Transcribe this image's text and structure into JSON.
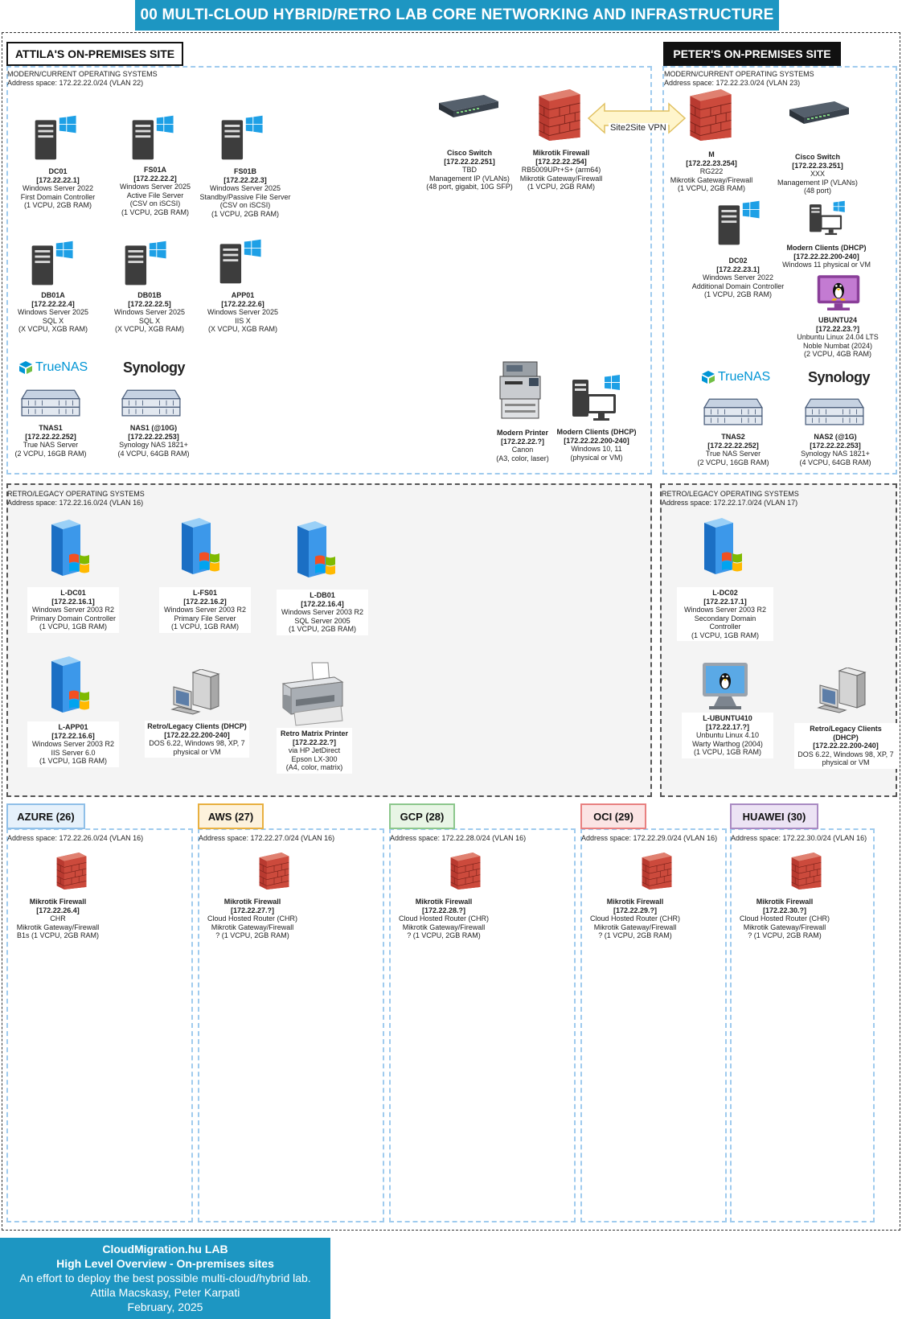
{
  "title": "00 MULTI-CLOUD HYBRID/RETRO LAB CORE NETWORKING AND INFRASTRUCTURE",
  "attila": {
    "label": "ATTILA'S ON-PREMISES SITE",
    "modern": {
      "heading": "MODERN/CURRENT OPERATING SYSTEMS",
      "address": "Address space: 172.22.22.0/24 (VLAN 22)"
    },
    "legacy": {
      "heading": "RETRO/LEGACY OPERATING SYSTEMS",
      "address": "Address space: 172.22.16.0/24 (VLAN 16)"
    },
    "devices": {
      "dc01": [
        "DC01",
        "[172.22.22.1]",
        "Windows Server 2022",
        "First Domain Controller",
        "(1 VCPU, 2GB RAM)"
      ],
      "fs01a": [
        "FS01A",
        "[172.22.22.2]",
        "Windows Server 2025",
        "Active File Server",
        "(CSV on iSCSI)",
        "(1 VCPU, 2GB RAM)"
      ],
      "fs01b": [
        "FS01B",
        "[172.22.22.3]",
        "Windows Server 2025",
        "Standby/Passive File Server",
        "(CSV on iSCSI)",
        "(1 VCPU, 2GB RAM)"
      ],
      "db01a": [
        "DB01A",
        "[172.22.22.4]",
        "Windows Server 2025",
        "SQL X",
        "(X VCPU, XGB RAM)"
      ],
      "db01b": [
        "DB01B",
        "[172.22.22.5]",
        "Windows Server 2025",
        "SQL X",
        "(X VCPU, XGB RAM)"
      ],
      "app01": [
        "APP01",
        "[172.22.22.6]",
        "Windows Server 2025",
        "IIS X",
        "(X VCPU, XGB RAM)"
      ],
      "switch": [
        "Cisco Switch",
        "[172.22.22.251]",
        "TBD",
        "Management IP (VLANs)",
        "(48 port, gigabit, 10G SFP)"
      ],
      "firewall": [
        "Mikrotik Firewall",
        "[172.22.22.254]",
        "RB5009UPr+S+ (arm64)",
        "Mikrotik Gateway/Firewall",
        "(1 VCPU, 2GB RAM)"
      ],
      "tnas1": [
        "TNAS1",
        "[172.22.22.252]",
        "True NAS Server",
        "(2 VCPU, 16GB RAM)"
      ],
      "nas1": [
        "NAS1 (@10G)",
        "[172.22.22.253]",
        "Synology NAS 1821+",
        "(4 VCPU, 64GB RAM)"
      ],
      "printer": [
        "Modern Printer",
        "[172.22.22.?]",
        "Canon",
        "(A3, color, laser)"
      ],
      "clients": [
        "Modern Clients (DHCP)",
        "[172.22.22.200-240]",
        "Windows 10, 11",
        "(physical or VM)"
      ],
      "ldc01": [
        "L-DC01",
        "[172.22.16.1]",
        "Windows Server 2003 R2",
        "Primary Domain Controller",
        "(1 VCPU, 1GB RAM)"
      ],
      "lfs01": [
        "L-FS01",
        "[172.22.16.2]",
        "Windows Server 2003 R2",
        "Primary File Server",
        "(1 VCPU, 1GB RAM)"
      ],
      "ldb01": [
        "L-DB01",
        "[172.22.16.4]",
        "Windows Server 2003 R2",
        "SQL Server 2005",
        "(1 VCPU, 2GB RAM)"
      ],
      "lapp01": [
        "L-APP01",
        "[172.22.16.6]",
        "Windows Server 2003 R2",
        "IIS Server 6.0",
        "(1 VCPU, 1GB RAM)"
      ],
      "retroclients": [
        "Retro/Legacy Clients (DHCP)",
        "[172.22.22.200-240]",
        "DOS 6.22, Windows 98, XP, 7",
        "physical or VM"
      ],
      "retroprinter": [
        "Retro Matrix Printer",
        "[172.22.22.?]",
        "via HP JetDirect",
        "Epson LX-300",
        "(A4, color, matrix)"
      ]
    }
  },
  "peter": {
    "label": "PETER'S ON-PREMISES SITE",
    "modern": {
      "heading": "MODERN/CURRENT OPERATING SYSTEMS",
      "address": "Address space: 172.22.23.0/24 (VLAN 23)"
    },
    "legacy": {
      "heading": "RETRO/LEGACY OPERATING SYSTEMS",
      "address": "Address space: 172.22.17.0/24 (VLAN 17)"
    },
    "devices": {
      "firewall": [
        "M",
        "[172.22.23.254]",
        "RG222",
        "Mikrotik Gateway/Firewall",
        "(1 VCPU, 2GB RAM)"
      ],
      "switch": [
        "Cisco Switch",
        "[172.22.23.251]",
        "XXX",
        "Management IP (VLANs)",
        "(48 port)"
      ],
      "dc02": [
        "DC02",
        "[172.22.23.1]",
        "Windows Server 2022",
        "Additional Domain Controller",
        "(1 VCPU, 2GB RAM)"
      ],
      "clients": [
        "Modern Clients (DHCP)",
        "[172.22.22.200-240]",
        "Windows 11 physical or VM"
      ],
      "ubuntu24": [
        "UBUNTU24",
        "[172.22.23.?]",
        "Unbuntu Linux 24.04 LTS",
        "Noble Numbat (2024)",
        "(2 VCPU, 4GB RAM)"
      ],
      "tnas2": [
        "TNAS2",
        "[172.22.22.252]",
        "True NAS Server",
        "(2 VCPU, 16GB RAM)"
      ],
      "nas2": [
        "NAS2 (@1G)",
        "[172.22.22.253]",
        "Synology NAS 1821+",
        "(4 VCPU, 64GB RAM)"
      ],
      "ldc02": [
        "L-DC02",
        "[172.22.17.1]",
        "Windows Server 2003 R2",
        "Secondary Domain Controller",
        "(1 VCPU, 1GB RAM)"
      ],
      "lubuntu": [
        "L-UBUNTU410",
        "[172.22.17.?]",
        "Unbuntu Linux 4.10",
        "Warty Warthog (2004)",
        "(1 VCPU, 1GB RAM)"
      ],
      "retroclients": [
        "Retro/Legacy Clients (DHCP)",
        "[172.22.22.200-240]",
        "DOS 6.22, Windows 98, XP, 7",
        "physical or VM"
      ]
    }
  },
  "vpn_label": "Site2Site VPN",
  "logos": {
    "truenas": "TrueNAS",
    "synology": "Synology"
  },
  "clouds": [
    {
      "label": "AZURE (26)",
      "address": "Address space: 172.22.26.0/24 (VLAN 16)",
      "border": "#8fbfe8",
      "fill": "#e6f1fb",
      "device": [
        "Mikrotik Firewall",
        "[172.22.26.4]",
        "CHR",
        "Mikrotik Gateway/Firewall",
        "B1s (1 VCPU, 2GB RAM)"
      ]
    },
    {
      "label": "AWS (27)",
      "address": "Address space: 172.22.27.0/24 (VLAN 16)",
      "border": "#e8b040",
      "fill": "#fdf2dc",
      "device": [
        "Mikrotik Firewall",
        "[172.22.27.?]",
        "Cloud Hosted Router (CHR)",
        "Mikrotik Gateway/Firewall",
        "? (1 VCPU, 2GB RAM)"
      ]
    },
    {
      "label": "GCP (28)",
      "address": "Address space: 172.22.28.0/24 (VLAN 16)",
      "border": "#8cc78c",
      "fill": "#e8f5e5",
      "device": [
        "Mikrotik Firewall",
        "[172.22.28.?]",
        "Cloud Hosted Router (CHR)",
        "Mikrotik Gateway/Firewall",
        "? (1 VCPU, 2GB RAM)"
      ]
    },
    {
      "label": "OCI (29)",
      "address": "Address space: 172.22.29.0/24 (VLAN 16)",
      "border": "#e88080",
      "fill": "#fbe4e4",
      "device": [
        "Mikrotik Firewall",
        "[172.22.29.?]",
        "Cloud Hosted Router (CHR)",
        "Mikrotik Gateway/Firewall",
        "? (1 VCPU, 2GB RAM)"
      ]
    },
    {
      "label": "HUAWEI (30)",
      "address": "Address space: 172.22.30.0/24 (VLAN 16)",
      "border": "#a98ac2",
      "fill": "#ece3f4",
      "device": [
        "Mikrotik Firewall",
        "[172.22.30.?]",
        "Cloud Hosted Router (CHR)",
        "Mikrotik Gateway/Firewall",
        "? (1 VCPU, 2GB RAM)"
      ]
    }
  ],
  "footer": {
    "line1": "CloudMigration.hu LAB",
    "line2": "High Level Overview - On-premises sites",
    "line3": "An effort to deploy the best possible multi-cloud/hybrid lab.",
    "line4": "Attila Macskasy, Peter Karpati",
    "line5": "February, 2025"
  }
}
